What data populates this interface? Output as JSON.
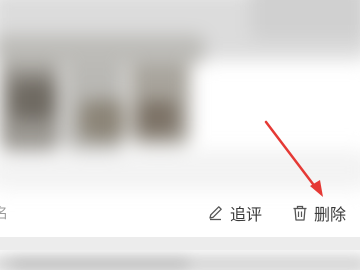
{
  "review_card": {
    "anonymous_label": "名",
    "actions": {
      "follow_up_label": "追评",
      "delete_label": "删除"
    }
  },
  "colors": {
    "accent_arrow": "#e53935",
    "background": "#ececec",
    "card": "#ffffff"
  },
  "icons": {
    "follow_up": "pencil-icon",
    "delete": "trash-icon"
  }
}
